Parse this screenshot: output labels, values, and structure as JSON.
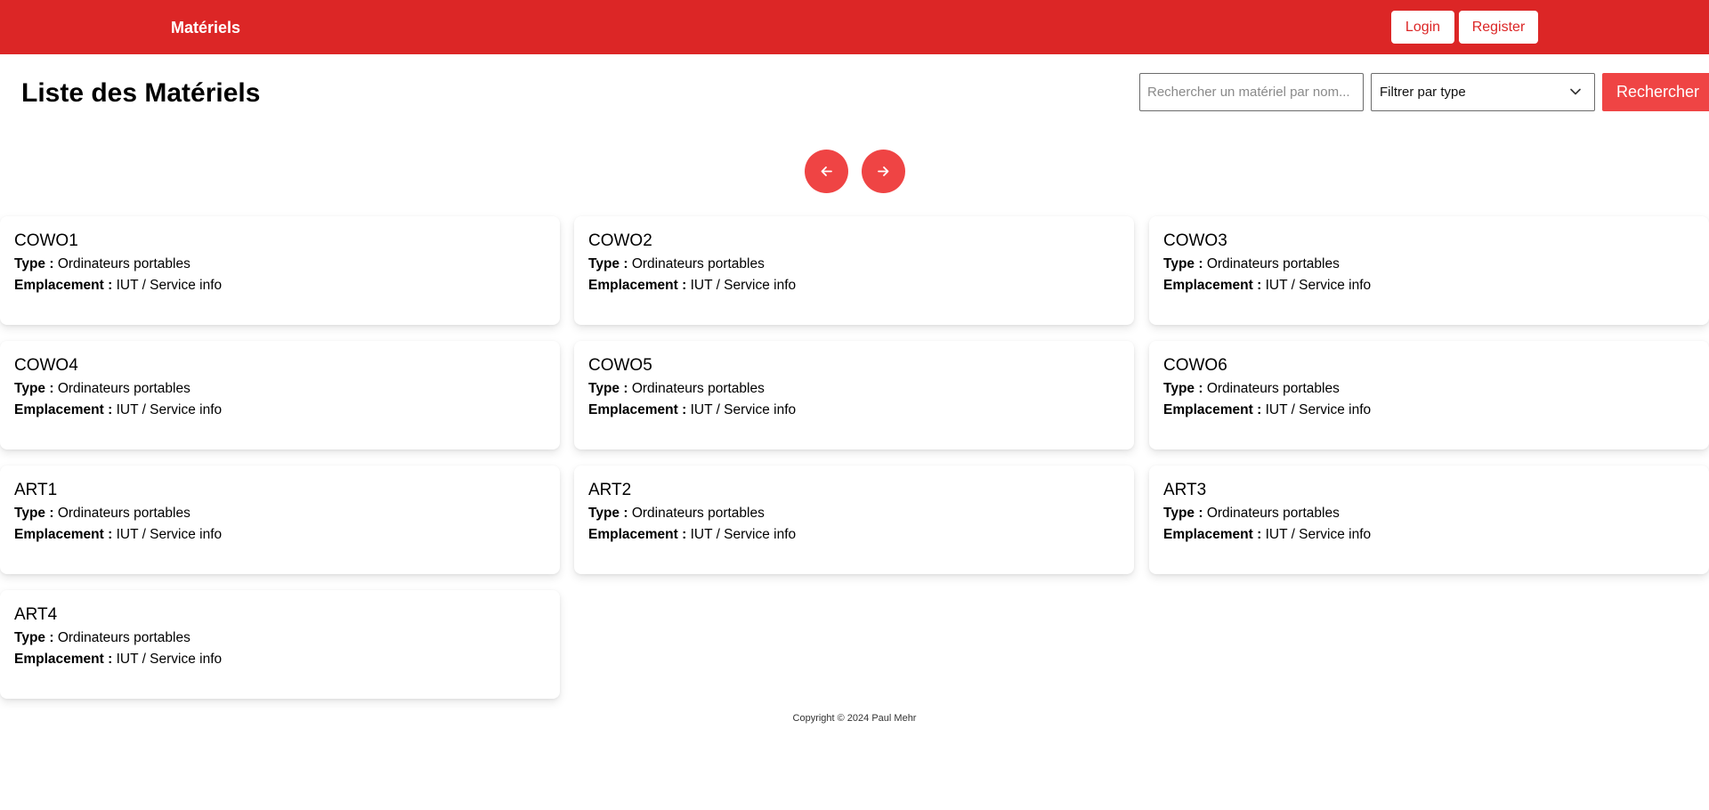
{
  "header": {
    "brand": "Matériels",
    "login_label": "Login",
    "register_label": "Register"
  },
  "main": {
    "title": "Liste des Matériels",
    "search_placeholder": "Rechercher un matériel par nom...",
    "filter_selected": "Filtrer par type",
    "search_button": "Rechercher"
  },
  "labels": {
    "type": "Type :",
    "location": "Emplacement :"
  },
  "items": [
    {
      "name": "COWO1",
      "type": "Ordinateurs portables",
      "location": "IUT / Service info"
    },
    {
      "name": "COWO2",
      "type": "Ordinateurs portables",
      "location": "IUT / Service info"
    },
    {
      "name": "COWO3",
      "type": "Ordinateurs portables",
      "location": "IUT / Service info"
    },
    {
      "name": "COWO4",
      "type": "Ordinateurs portables",
      "location": "IUT / Service info"
    },
    {
      "name": "COWO5",
      "type": "Ordinateurs portables",
      "location": "IUT / Service info"
    },
    {
      "name": "COWO6",
      "type": "Ordinateurs portables",
      "location": "IUT / Service info"
    },
    {
      "name": "ART1",
      "type": "Ordinateurs portables",
      "location": "IUT / Service info"
    },
    {
      "name": "ART2",
      "type": "Ordinateurs portables",
      "location": "IUT / Service info"
    },
    {
      "name": "ART3",
      "type": "Ordinateurs portables",
      "location": "IUT / Service info"
    },
    {
      "name": "ART4",
      "type": "Ordinateurs portables",
      "location": "IUT / Service info"
    }
  ],
  "footer": {
    "copyright": "Copyright © 2024 Paul Mehr"
  },
  "icons": {
    "prev": "arrow-left-icon",
    "next": "arrow-right-icon",
    "dropdown": "chevron-down-icon"
  },
  "colors": {
    "header_bg": "#dc2626",
    "accent": "#ef4444",
    "text": "#000000"
  }
}
